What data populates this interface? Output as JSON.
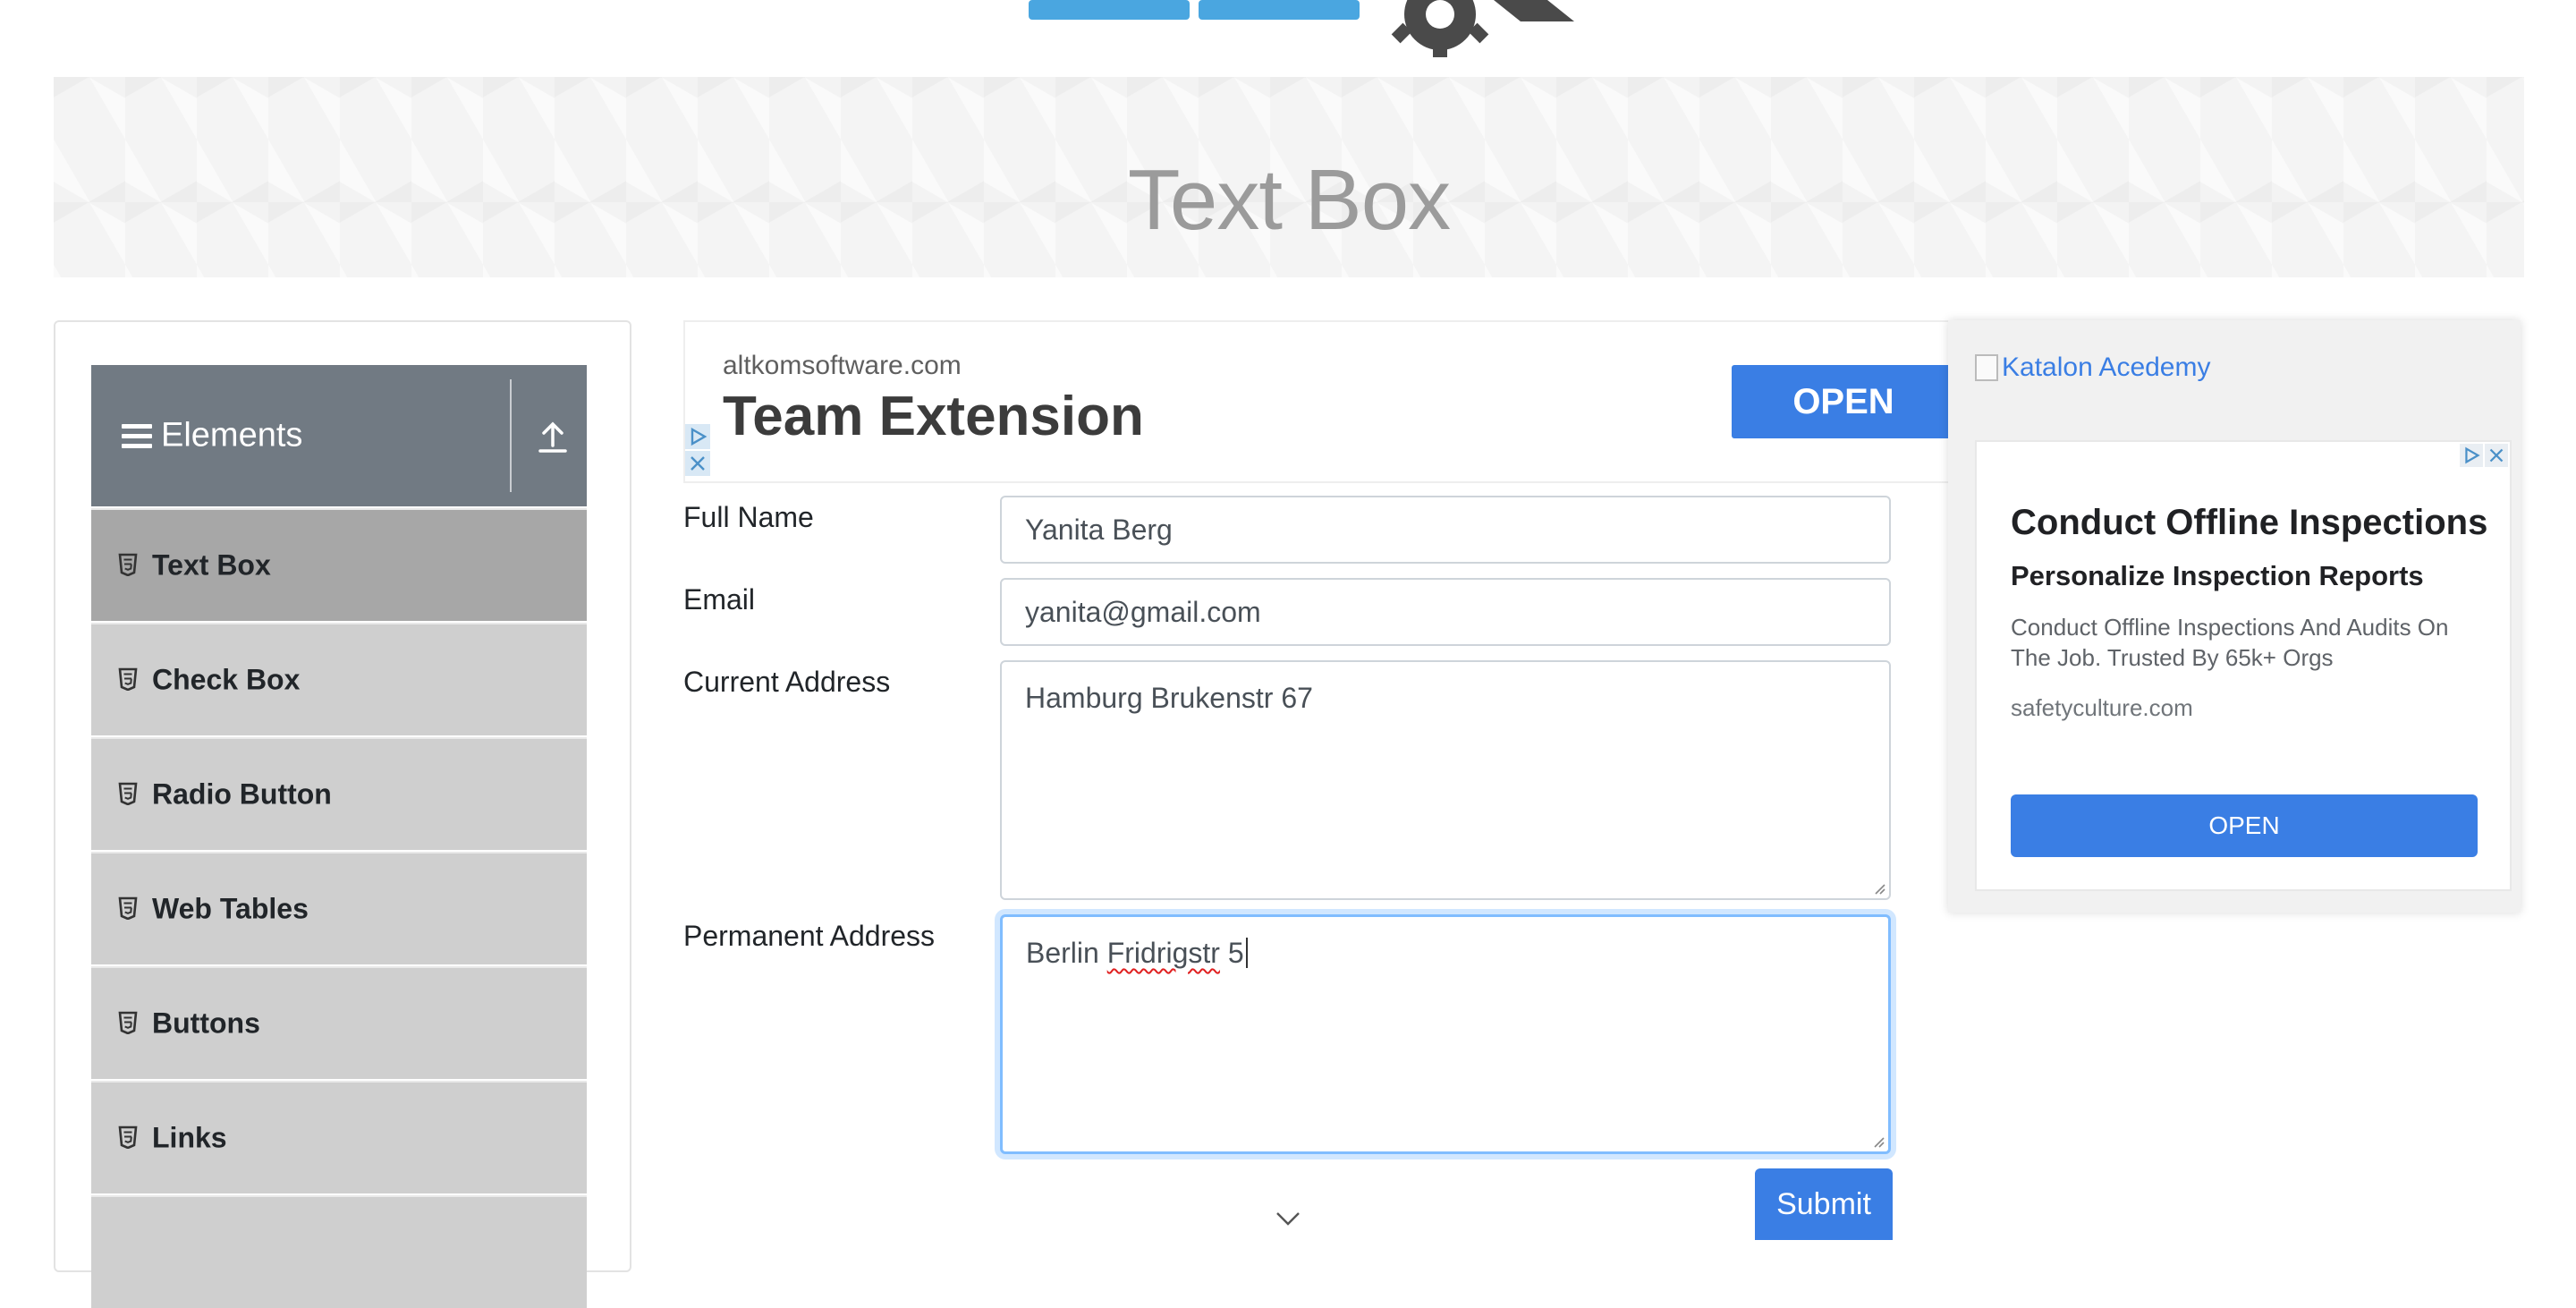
{
  "page": {
    "title": "Text Box"
  },
  "sidebar": {
    "group_title": "Elements",
    "items": [
      {
        "label": "Text Box",
        "active": true
      },
      {
        "label": "Check Box",
        "active": false
      },
      {
        "label": "Radio Button",
        "active": false
      },
      {
        "label": "Web Tables",
        "active": false
      },
      {
        "label": "Buttons",
        "active": false
      },
      {
        "label": "Links",
        "active": false
      }
    ]
  },
  "ad_top": {
    "domain": "altkomsoftware.com",
    "headline": "Team Extension",
    "cta": "OPEN"
  },
  "form": {
    "full_name": {
      "label": "Full Name",
      "value": "Yanita Berg"
    },
    "email": {
      "label": "Email",
      "value": "yanita@gmail.com"
    },
    "current_address": {
      "label": "Current Address",
      "value": "Hamburg Brukenstr 67"
    },
    "permanent_address": {
      "label": "Permanent Address",
      "value_before": "Berlin ",
      "value_misspelled": "Fridrigstr",
      "value_after": " 5"
    },
    "submit_label": "Submit"
  },
  "ad_right": {
    "image_alt": "Katalon Acedemy",
    "headline": "Conduct Offline Inspections",
    "subheadline": "Personalize Inspection Reports",
    "description": "Conduct Offline Inspections And Audits On The Job. Trusted By 65k+ Orgs",
    "source": "safetyculture.com",
    "cta": "OPEN"
  },
  "colors": {
    "accent": "#3a7ee4",
    "sidebar_header": "#717a83",
    "sidebar_item": "#cfcfcf",
    "sidebar_item_active": "#a7a7a7",
    "title_gray": "#9b9b9b"
  }
}
